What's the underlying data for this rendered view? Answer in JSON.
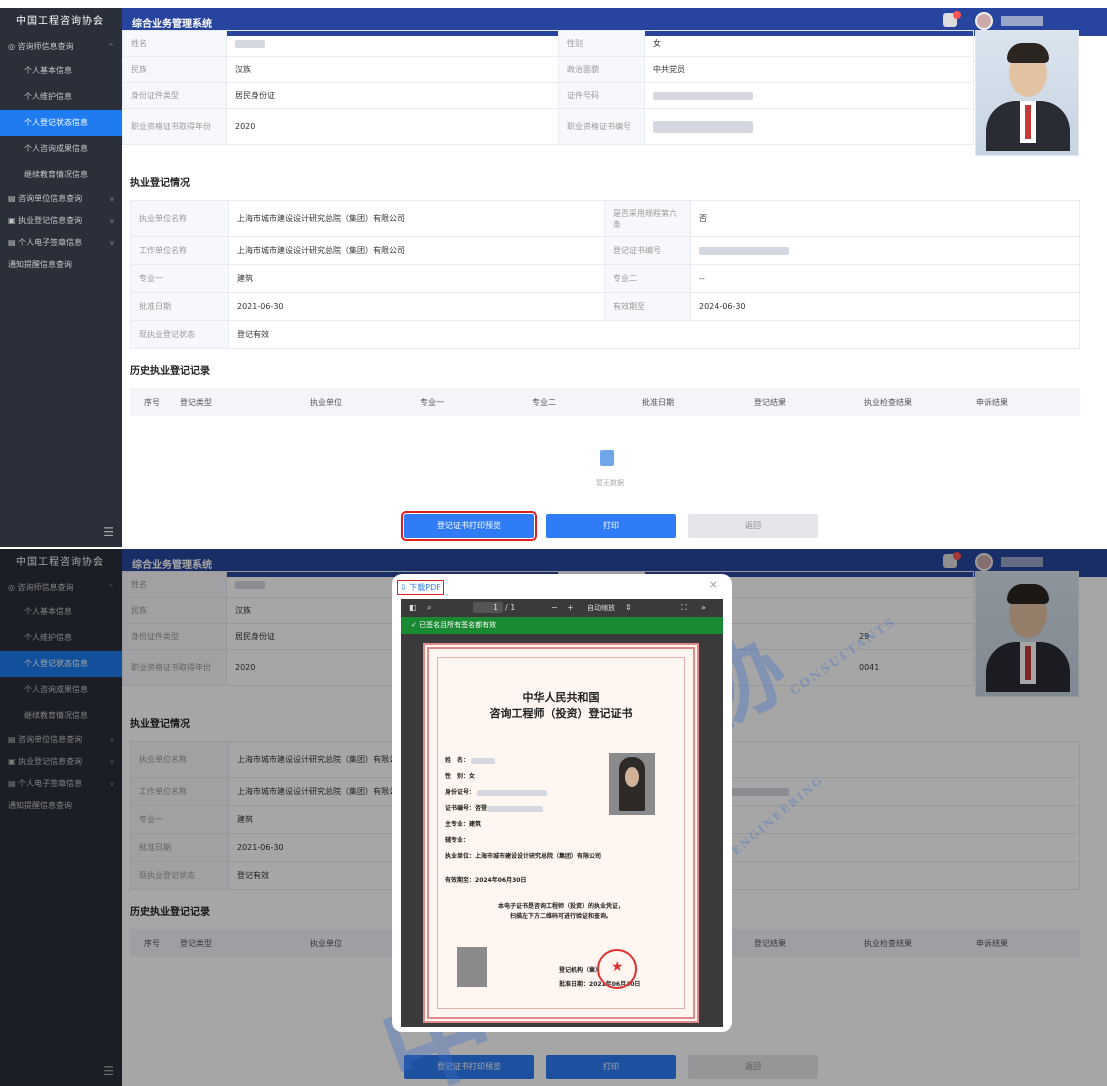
{
  "app": {
    "logo_text": "中国工程咨询协会",
    "system_title": "综合业务管理系统"
  },
  "sidebar": {
    "group_consultant": "咨询师信息查询",
    "items": [
      "个人基本信息",
      "个人维护信息",
      "个人登记状态信息",
      "个人咨询成果信息",
      "继续教育情况信息"
    ],
    "group_unit": "咨询单位信息查询",
    "group_practice": "执业登记信息查询",
    "group_esign": "个人电子签章信息",
    "notice": "通知提醒信息查询",
    "active_index": 2
  },
  "basic_info": {
    "name_label": "姓名",
    "gender_label": "性别",
    "gender": "女",
    "ethnicity_label": "民族",
    "ethnicity": "汉族",
    "political_label": "政治面貌",
    "political": "中共党员",
    "id_type_label": "身份证件类型",
    "id_type": "居民身份证",
    "id_no_label": "证件号码",
    "qual_year_label": "职业资格证书取得年份",
    "qual_year": "2020",
    "qual_no_label": "职业资格证书编号"
  },
  "registration": {
    "section_title": "执业登记情况",
    "unit_label": "执业单位名称",
    "unit": "上海市城市建设设计研究总院（集团）有限公司",
    "rule_label": "是否采用规程第六条",
    "rule": "否",
    "work_unit_label": "工作单位名称",
    "work_unit": "上海市城市建设设计研究总院（集团）有限公司",
    "cert_no_label": "登记证书编号",
    "major1_label": "专业一",
    "major1": "建筑",
    "major2_label": "专业二",
    "major2": "--",
    "approve_label": "批准日期",
    "approve": "2021-06-30",
    "valid_label": "有效期至",
    "valid": "2024-06-30",
    "status_label": "现执业登记状态",
    "status": "登记有效"
  },
  "history": {
    "section_title": "历史执业登记记录",
    "columns": [
      "序号",
      "登记类型",
      "执业单位",
      "专业一",
      "专业二",
      "批准日期",
      "登记结果",
      "执业检查结果",
      "申诉结果"
    ],
    "empty_text": "暂无数据"
  },
  "buttons": {
    "preview": "登记证书打印预览",
    "print": "打印",
    "back": "返回"
  },
  "dialog": {
    "download_pdf": "下载PDF",
    "page_indicator": "1",
    "page_total": "/ 1",
    "zoom": "自动缩放",
    "signature_status": "已签名且所有签名都有效"
  },
  "partial_values": {
    "id_tail": "29",
    "qual_tail": "0041",
    "valid_tail": "06-30"
  },
  "certificate": {
    "title1": "中华人民共和国",
    "title2": "咨询工程师（投资）登记证书",
    "name_label": "姓　名：",
    "gender_label": "性　别：",
    "gender": "女",
    "id_label": "身份证号：",
    "cert_no_label": "证书编号：",
    "cert_no_prefix": "咨登",
    "major_label": "主专业：",
    "major": "建筑",
    "aux_major_label": "辅专业：",
    "unit_label": "执业单位：",
    "unit": "上海市城市建设设计研究总院（集团）有限公司",
    "valid_label": "有效期至：",
    "valid": "2024年06月30日",
    "note1": "本电子证书是咨询工程师（投资）的执业凭证，",
    "note2": "扫描左下方二维码可进行验证和查询。",
    "authority_label": "登记机构（章）",
    "approve_label": "批准日期：",
    "approve": "2021年06月30日"
  },
  "watermark": {
    "cn": "中国工程咨询协会",
    "en": "CHINA NATIONAL ASSOCIATION OF ENGINEERING CONSULTANTS"
  }
}
